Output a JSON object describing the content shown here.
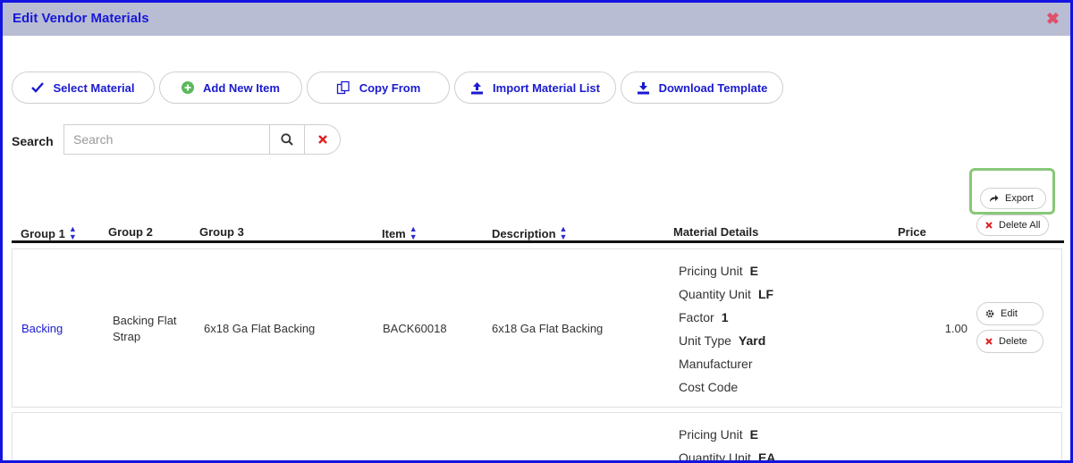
{
  "window": {
    "title": "Edit Vendor Materials"
  },
  "toolbar": {
    "select_material": "Select Material",
    "add_new_item": "Add New Item",
    "copy_from": "Copy From",
    "import_material_list": "Import Material List",
    "download_template": "Download Template"
  },
  "search": {
    "label": "Search",
    "placeholder": "Search",
    "value": ""
  },
  "actions": {
    "export": "Export",
    "delete_all": "Delete All"
  },
  "columns": {
    "group1": "Group 1",
    "group2": "Group 2",
    "group3": "Group 3",
    "item": "Item",
    "description": "Description",
    "material_details": "Material Details",
    "price": "Price"
  },
  "detail_labels": {
    "pricing_unit": "Pricing Unit",
    "quantity_unit": "Quantity Unit",
    "factor": "Factor",
    "unit_type": "Unit Type",
    "manufacturer": "Manufacturer",
    "cost_code": "Cost Code"
  },
  "rows": [
    {
      "group1": "Backing",
      "group2": "Backing Flat Strap",
      "group3": "6x18 Ga Flat Backing",
      "item": "BACK60018",
      "description": "6x18 Ga Flat Backing",
      "pricing_unit": "E",
      "quantity_unit": "LF",
      "factor": "1",
      "unit_type": "Yard",
      "manufacturer": "",
      "cost_code": "",
      "price": "1.00",
      "edit_label": "Edit",
      "delete_label": "Delete"
    },
    {
      "pricing_unit": "E",
      "quantity_unit": "EA"
    }
  ],
  "colors": {
    "accent": "#1a1ad0",
    "titlebar": "#b8bdd3",
    "frame": "#1414e0",
    "close": "#e0506a",
    "delete": "#e02020",
    "add_green": "#5cb85c",
    "highlight": "#88c878"
  },
  "icons": {
    "select_material": "check-icon",
    "add_new_item": "plus-circle-icon",
    "copy_from": "copy-icon",
    "import_material_list": "upload-icon",
    "download_template": "download-icon",
    "search": "search-icon",
    "clear": "close-icon",
    "export": "share-arrow-icon",
    "delete": "close-icon",
    "edit": "gear-icon"
  }
}
